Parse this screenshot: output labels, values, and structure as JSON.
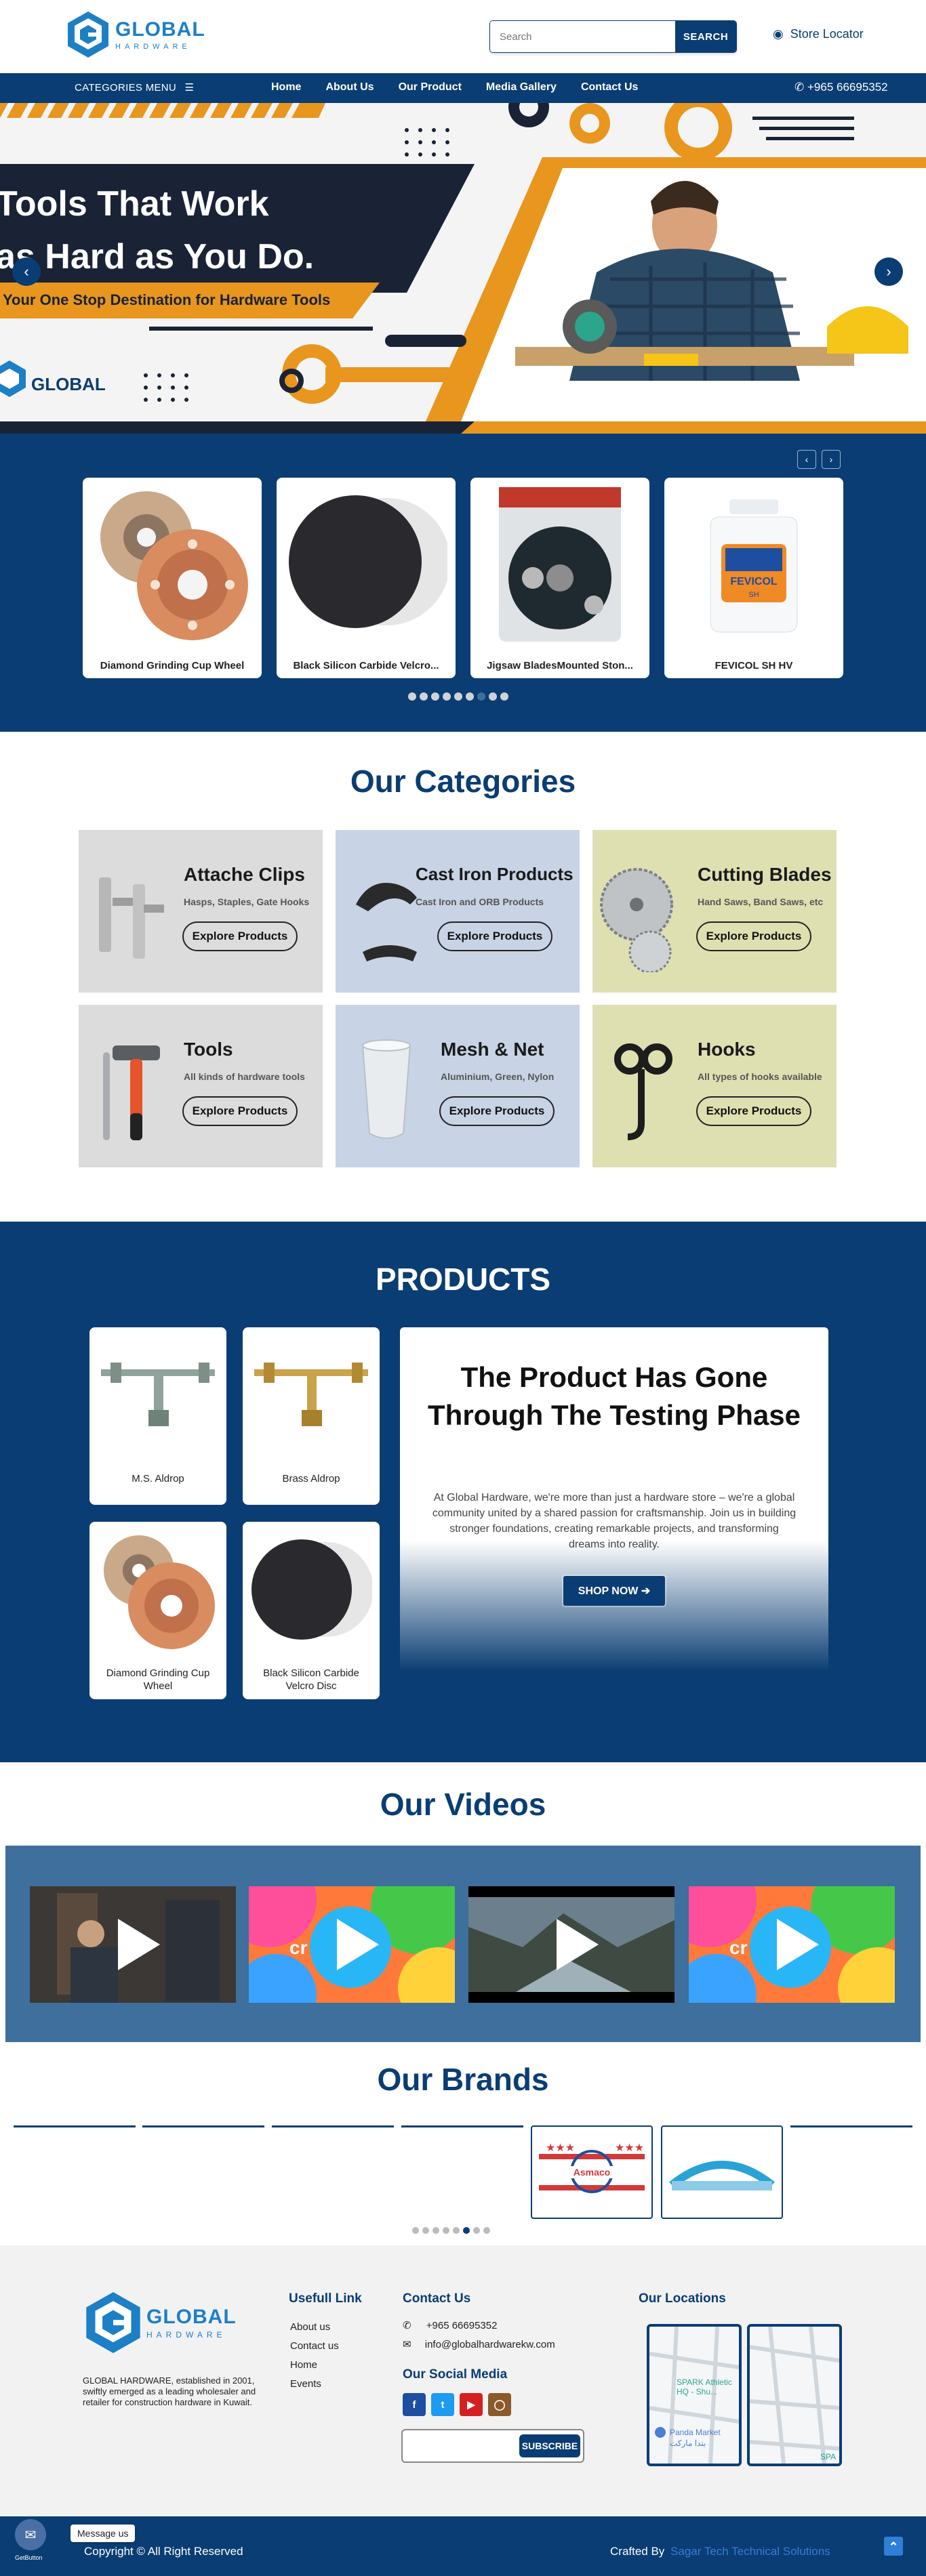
{
  "header": {
    "logo_text": "GLOBAL",
    "logo_sub": "HARDWARE",
    "search_placeholder": "Search",
    "search_button": "SEARCH",
    "store_locator": "Store Locator"
  },
  "nav": {
    "categories_menu": "CATEGORIES MENU",
    "links": [
      "Home",
      "About Us",
      "Our Product",
      "Media Gallery",
      "Contact Us"
    ],
    "phone": "+965 66695352"
  },
  "hero": {
    "line1": "Tools That Work",
    "line2": "as Hard as You Do.",
    "subtitle": "Your One Stop Destination for Hardware Tools",
    "logo_text": "GLOBAL",
    "prev": "‹",
    "next": "›"
  },
  "carousel": {
    "items": [
      "Diamond Grinding Cup Wheel",
      "Black Silicon Carbide Velcro...",
      "Jigsaw BladesMounted Ston...",
      "FEVICOL SH HV"
    ],
    "prev": "‹",
    "next": "›",
    "fevicol_label": "FEVICOL",
    "fevicol_sub": "SH"
  },
  "categories": {
    "title": "Our Categories",
    "items": [
      {
        "name": "Attache Clips",
        "sub": "Hasps, Staples, Gate Hooks",
        "button": "Explore Products"
      },
      {
        "name": "Cast Iron Products",
        "sub": "Cast Iron and ORB Products",
        "button": "Explore Products"
      },
      {
        "name": "Cutting Blades",
        "sub": "Hand Saws, Band Saws, etc",
        "button": "Explore Products"
      },
      {
        "name": "Tools",
        "sub": "All kinds of hardware tools",
        "button": "Explore Products"
      },
      {
        "name": "Mesh & Net",
        "sub": "Aluminium, Green, Nylon",
        "button": "Explore Products"
      },
      {
        "name": "Hooks",
        "sub": "All types of hooks available",
        "button": "Explore Products"
      }
    ],
    "colors": [
      "#dcdcdc",
      "#c8d3e6",
      "#dfe0b2",
      "#dcdcdc",
      "#c8d3e6",
      "#dfe0b2"
    ]
  },
  "products": {
    "title": "PRODUCTS",
    "items": [
      "M.S. Aldrop",
      "Brass Aldrop",
      "Diamond Grinding Cup Wheel",
      "Black Silicon Carbide Velcro Disc"
    ],
    "promo_title": "The Product Has Gone Through The Testing Phase",
    "promo_text": "At Global Hardware, we're more than just a hardware store – we're a global community united by a shared passion for craftsmanship. Join us in building stronger foundations, creating remarkable projects, and transforming dreams into reality.",
    "shop_button": "SHOP NOW ➔"
  },
  "videos": {
    "title": "Our Videos",
    "brand_text": "cr"
  },
  "brands": {
    "title": "Our Brands",
    "brand_name": "Asmaco"
  },
  "footer": {
    "logo_text": "GLOBAL",
    "logo_sub": "HARDWARE",
    "about": "GLOBAL HARDWARE, established in 2001, swiftly emerged as a leading wholesaler and retailer for construction hardware in Kuwait.",
    "useful_title": "Usefull Link",
    "useful_links": [
      "About us",
      "Contact us",
      "Home",
      "Events"
    ],
    "contact_title": "Contact Us",
    "contact_phone": "+965 66695352",
    "contact_email": "info@globalhardwarekw.com",
    "social_title": "Our Social Media",
    "subscribe_button": "SUBSCRIBE",
    "locations_title": "Our Locations",
    "map1_label1": "SPARK Athletic",
    "map1_label2": "HQ - Shu...",
    "map1_label3": "Panda Market",
    "map1_label4": "بندا ماركت",
    "map2_label": "SPA",
    "copyright": "Copyright © All Right Reserved",
    "crafted_by": "Crafted By",
    "crafter": "Sagar Tech Technical Solutions",
    "message_us": "Message us",
    "getbutton": "GetButton",
    "top_arrow": "⌃"
  },
  "accent": "#0a3d73",
  "hero_orange": "#e8961e"
}
